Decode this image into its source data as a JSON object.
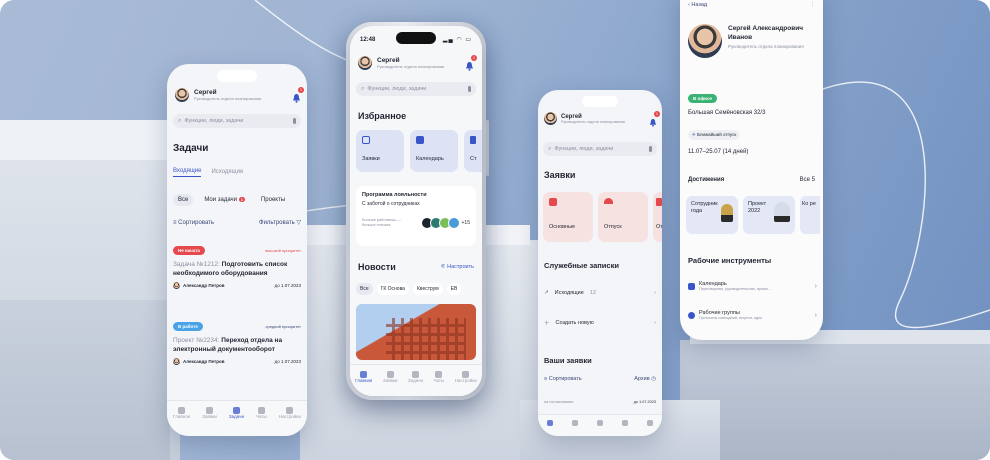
{
  "left": {
    "name": "Сергей",
    "role": "Руководитель отдела планирования",
    "bell_count": "1",
    "search_placeholder": "Функции, люди, задачи",
    "tasks_title": "Задачи",
    "tabs": [
      "Входящие",
      "Исходящие"
    ],
    "filters": [
      "Все",
      "Мои задачи",
      "Проекты"
    ],
    "filters_badge": "1",
    "sort": "Сортировать",
    "filter": "Фильтровать",
    "task1": {
      "status": "Не начата",
      "priority": "высокий приоритет",
      "prefix": "Задача №1212:",
      "title": "Подготовить список необходимого оборудования",
      "person": "Александр Петров",
      "due": "до 1.07.2023"
    },
    "task2": {
      "status": "В работе",
      "priority": "средний приоритет",
      "prefix": "Проект №2234:",
      "title": "Переход отдела на электронный документооборот",
      "person": "Александр Петров",
      "due": "до 1.07.2023"
    },
    "nav": [
      "Главное",
      "Заявки",
      "Задачи",
      "Чаты",
      "Настройки"
    ]
  },
  "center": {
    "time": "12:48",
    "name": "Сергей",
    "role": "Руководитель отдела планирования",
    "bell_count": "1",
    "search_placeholder": "Функции, люди, задачи",
    "favorites_title": "Избранное",
    "favorites": [
      "Заявки",
      "Календарь",
      "Ст"
    ],
    "loyalty_title": "Программа лояльности",
    "loyalty_sub": "С заботой о сотрудниках",
    "loyalty_note": "Больше работаешь — больше плюшек",
    "loyalty_count": "+15",
    "news_title": "Новости",
    "news_settings": "Настроить",
    "news_chips": [
      "Все",
      "ГК Основа",
      "Квеструм",
      "EB"
    ],
    "nav": [
      "Главная",
      "Заявки",
      "Задачи",
      "Чаты",
      "Настройки"
    ]
  },
  "third": {
    "name": "Сергей",
    "role": "Руководитель отдела планирования",
    "bell_count": "1",
    "search_placeholder": "Функции, люди, задачи",
    "requests_title": "Заявки",
    "requests": [
      "Основные",
      "Отпуск",
      "От"
    ],
    "memos_title": "Служебные записки",
    "outgoing": "Исходящие",
    "outgoing_count": "12",
    "create_new": "Создать новую",
    "my_requests": "Ваши заявки",
    "sort": "Сортировать",
    "archive": "Архив",
    "status_small": "на согласовании",
    "due_small": "до 1.07.2023"
  },
  "profile": {
    "back": "Назад",
    "name": "Сергей Александрович Иванов",
    "role": "Руководитель отдела планирования",
    "status": "В офисе",
    "address": "Большая Семёновская 32/3",
    "vacation_label": "Ближайший отпуск",
    "vacation_dates": "11.07–25.07 (14 дней)",
    "achievements_title": "Достижения",
    "achievements_all": "Все 5",
    "achievements": [
      "Сотрудник года",
      "Проект 2022",
      "Ко ре"
    ],
    "tools_title": "Рабочие инструменты",
    "tools": [
      {
        "name": "Календарь",
        "desc": "Переговорные, руководительство, время..."
      },
      {
        "name": "Рабочие группы",
        "desc": "Протоколы совещаний, встречи, идеи"
      }
    ]
  },
  "colors": {
    "accent": "#3a55c8",
    "red": "#e5484d",
    "green": "#3bb273",
    "blue": "#4aa3e6"
  }
}
